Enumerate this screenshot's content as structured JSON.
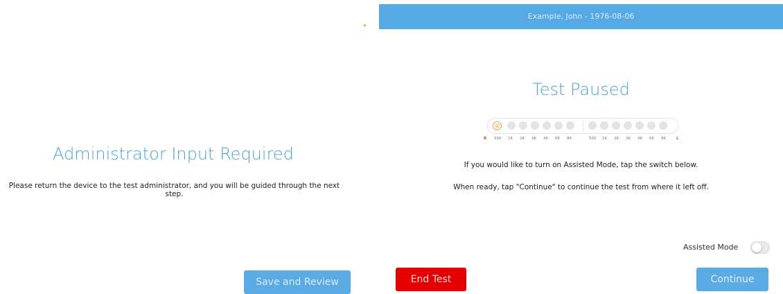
{
  "header": {
    "patient": "Example, John - 1976-08-06"
  },
  "left_panel": {
    "title": "Administrator Input Required",
    "message": "Please return the device to the test administrator, and you will be guided through the next step.",
    "save_button": "Save and Review"
  },
  "right_panel": {
    "title": "Test Paused",
    "progress": {
      "right_ear_label": "R",
      "left_ear_label": "L",
      "right_freqs": [
        "500",
        "1K",
        "2K",
        "3K",
        "4K",
        "6K",
        "8K"
      ],
      "left_freqs": [
        "500",
        "1K",
        "2K",
        "3K",
        "4K",
        "6K",
        "8K"
      ],
      "current_index": 0,
      "colors": {
        "active": "#e6a04a",
        "inactive": "#e3e3e3",
        "right": "#e0342b",
        "left": "#3a6fd0"
      }
    },
    "message_assist": "If you would like to turn on Assisted Mode, tap the switch below.",
    "message_continue": "When ready, tap \"Continue\" to continue the test from where it left off.",
    "assisted_mode_label": "Assisted Mode",
    "assisted_mode_on": false,
    "end_button": "End Test",
    "continue_button": "Continue"
  },
  "colors": {
    "accent": "#56a9e3",
    "danger": "#e40000",
    "title": "#4a9fd8"
  }
}
